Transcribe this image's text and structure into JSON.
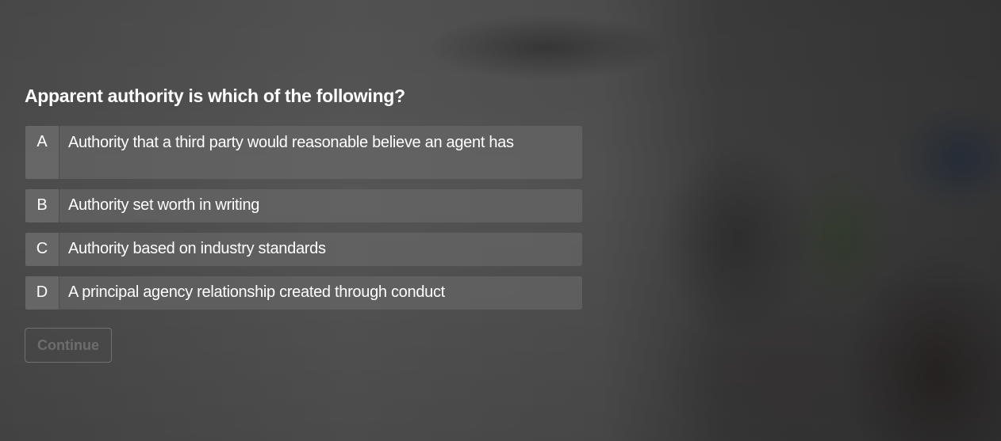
{
  "quiz": {
    "question": "Apparent authority is which of the following?",
    "options": [
      {
        "letter": "A",
        "text": "Authority that a third party would reasonable believe an agent has"
      },
      {
        "letter": "B",
        "text": "Authority set worth in writing"
      },
      {
        "letter": "C",
        "text": "Authority based on industry standards"
      },
      {
        "letter": "D",
        "text": "A principal agency relationship created through conduct"
      }
    ],
    "continue_label": "Continue"
  },
  "colors": {
    "question_text": "#ffffff",
    "option_background": "#6e6e6e",
    "continue_disabled_text": "#6d6d6d"
  }
}
